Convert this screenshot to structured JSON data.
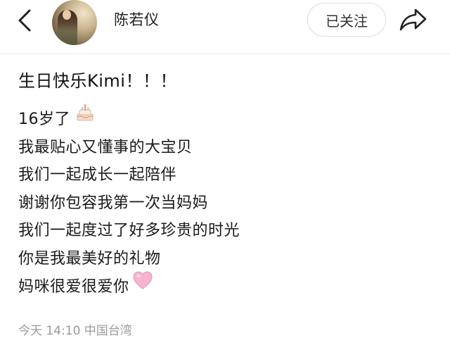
{
  "header": {
    "username": "陈若仪",
    "follow_label": "已关注",
    "back_icon": "chevron-left-icon",
    "share_icon": "share-arrow-icon"
  },
  "post": {
    "title": "生日快乐Kimi！！！",
    "lines": [
      "16岁了",
      "我最贴心又懂事的大宝贝",
      "我们一起成长一起陪伴",
      "谢谢你包容我第一次当妈妈",
      "我们一起度过了好多珍贵的时光",
      "你是我最美好的礼物",
      "妈咪很爱很爱你"
    ],
    "line1_emoji": "birthday-cake-icon",
    "line7_emoji": "pink-heart-icon"
  },
  "meta": {
    "text": "今天 14:10 中国台湾"
  },
  "colors": {
    "meta_gray": "#9a9a9a",
    "heart_pink": "#f5a3c7"
  }
}
